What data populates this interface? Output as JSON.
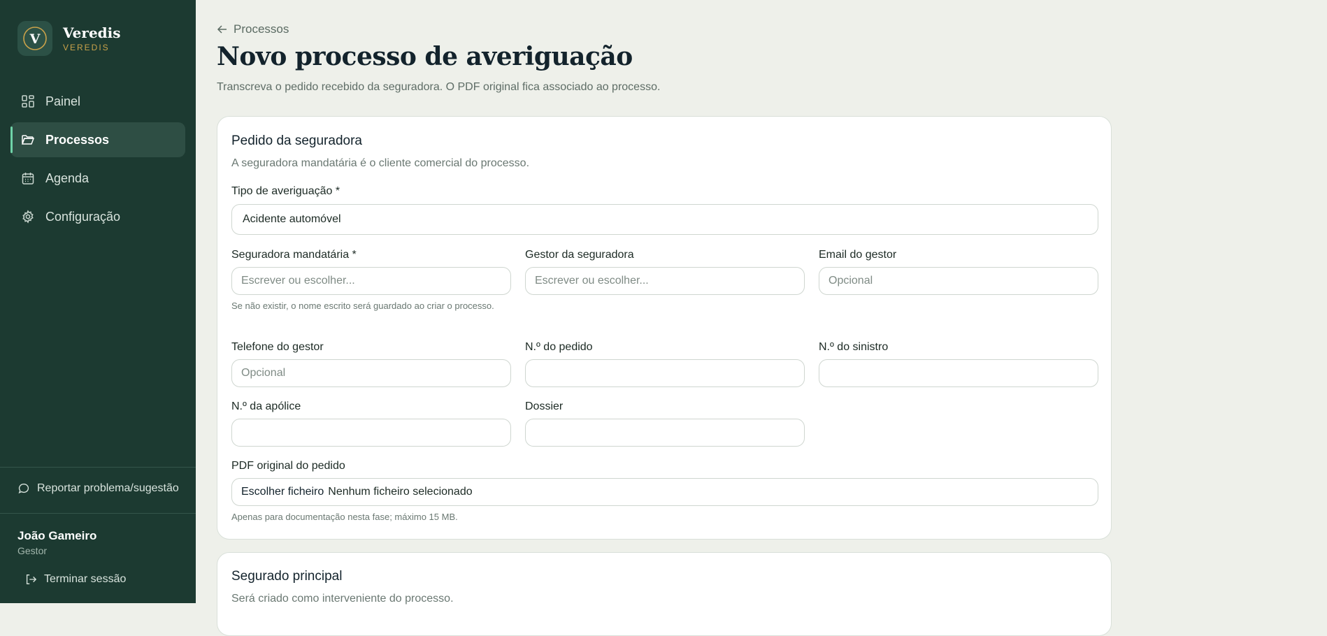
{
  "brand": {
    "name": "Veredis",
    "subtitle": "VEREDIS",
    "logo_letter": "V",
    "accent": "#c9a24a"
  },
  "sidebar": {
    "items": [
      {
        "label": "Painel",
        "icon": "dashboard-icon",
        "active": false
      },
      {
        "label": "Processos",
        "icon": "folder-icon",
        "active": true
      },
      {
        "label": "Agenda",
        "icon": "calendar-icon",
        "active": false
      },
      {
        "label": "Configuração",
        "icon": "gear-icon",
        "active": false
      }
    ],
    "report_label": "Reportar problema/sugestão",
    "user": {
      "name": "João Gameiro",
      "role": "Gestor"
    },
    "logout_label": "Terminar sessão"
  },
  "header": {
    "breadcrumb": "Processos",
    "title": "Novo processo de averiguação",
    "subtitle": "Transcreva o pedido recebido da seguradora. O PDF original fica associado ao processo."
  },
  "form": {
    "section_title": "Pedido da seguradora",
    "section_subtitle": "A seguradora mandatária é o cliente comercial do processo.",
    "tipo": {
      "label": "Tipo de averiguação *",
      "value": "Acidente automóvel"
    },
    "seguradora": {
      "label": "Seguradora mandatária *",
      "placeholder": "Escrever ou escolher...",
      "hint": "Se não existir, o nome escrito será guardado ao criar o processo."
    },
    "gestor": {
      "label": "Gestor da seguradora",
      "placeholder": "Escrever ou escolher..."
    },
    "email": {
      "label": "Email do gestor",
      "placeholder": "Opcional"
    },
    "telefone": {
      "label": "Telefone do gestor",
      "placeholder": "Opcional"
    },
    "pedido": {
      "label": "N.º do pedido",
      "value": ""
    },
    "sinistro": {
      "label": "N.º do sinistro",
      "value": ""
    },
    "apolice": {
      "label": "N.º da apólice",
      "value": ""
    },
    "dossier": {
      "label": "Dossier",
      "value": ""
    },
    "pdf": {
      "label": "PDF original do pedido",
      "button": "Escolher ficheiro",
      "status": "Nenhum ficheiro selecionado",
      "hint": "Apenas para documentação nesta fase; máximo 15 MB."
    }
  },
  "section2": {
    "title": "Segurado principal",
    "subtitle": "Será criado como interveniente do processo."
  }
}
